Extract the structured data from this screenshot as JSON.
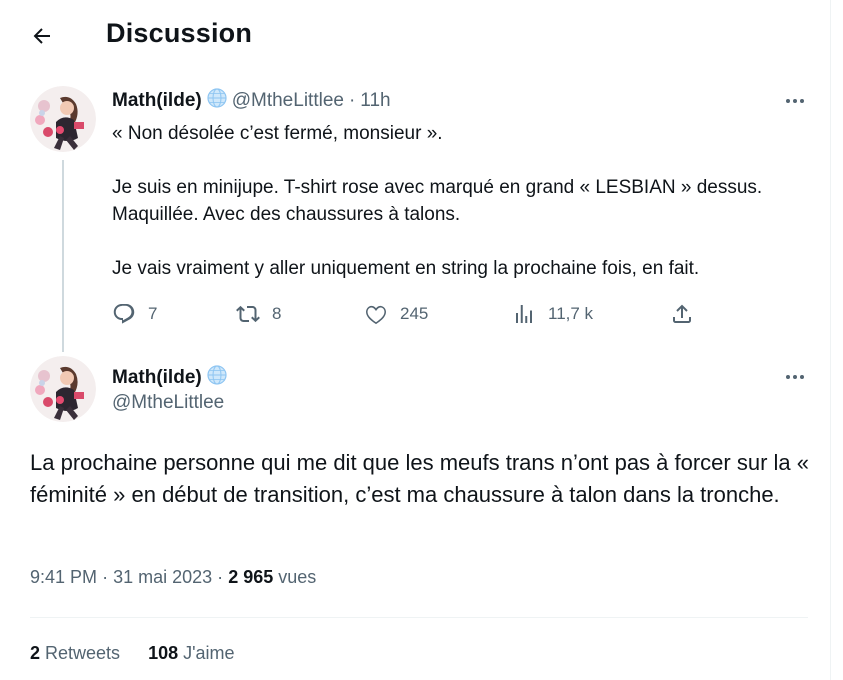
{
  "header": {
    "title": "Discussion",
    "back_icon": "arrow-left-icon"
  },
  "colors": {
    "text_primary": "#0f1419",
    "text_secondary": "#536471",
    "thread_line": "#cfd9de",
    "divider": "#eff3f4"
  },
  "parent_tweet": {
    "author_name": "Math(ilde)",
    "author_handle": "@MtheLittlee",
    "separator": "·",
    "time": "11h",
    "paragraphs": [
      "« Non désolée c’est fermé, monsieur ».",
      "Je suis en minijupe. T-shirt rose avec marqué en grand « LESBIAN » dessus. Maquillée. Avec des chaussures à talons.",
      "Je vais vraiment y aller uniquement en string la prochaine fois, en fait."
    ],
    "actions": {
      "replies": "7",
      "retweets": "8",
      "likes": "245",
      "views": "11,7 k"
    }
  },
  "main_tweet": {
    "author_name": "Math(ilde)",
    "author_handle": "@MtheLittlee",
    "text": "La prochaine personne qui me dit que les meufs trans n’ont pas à forcer sur la « féminité » en début de transition, c’est ma chaussure à talon dans la tronche.",
    "time": "9:41 PM",
    "date": "31 mai 2023",
    "separator": "·",
    "views_count": "2 965",
    "views_label": "vues",
    "retweets_count": "2",
    "retweets_label": "Retweets",
    "likes_count": "108",
    "likes_label": "J'aime"
  }
}
